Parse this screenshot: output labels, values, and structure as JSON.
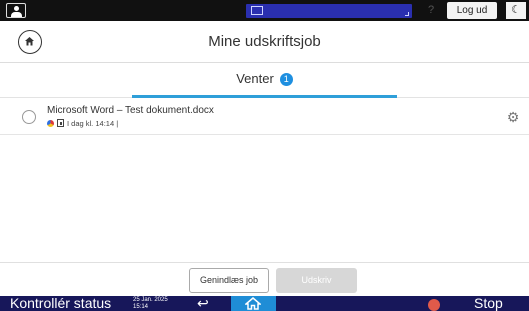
{
  "topbar": {
    "user_icon": "user-icon",
    "help_icon": "help-icon",
    "help_symbol": "?",
    "logout_label": "Log ud",
    "moon_icon": "moon-icon",
    "moon_symbol": "☾"
  },
  "header": {
    "home_icon": "home-icon",
    "title": "Mine udskriftsjob"
  },
  "tab": {
    "label": "Venter",
    "badge": "1"
  },
  "jobs": [
    {
      "name": "Microsoft Word – Test dokument.docx",
      "meta": "I dag kl. 14:14 |",
      "color_icon": "color-icon",
      "doc_icon": "document-icon",
      "settings_icon": "gear-icon",
      "settings_symbol": "⚙"
    }
  ],
  "actions": {
    "reload_label": "Genindlæs job",
    "print_label": "Udskriv"
  },
  "statusbar": {
    "status_label": "Kontrollér status",
    "date_line1": "25 Jan. 2025",
    "date_line2": "15:14",
    "back_icon": "back-arrow-icon",
    "back_symbol": "↩",
    "home_icon": "home-icon",
    "stop_icon": "stop-icon",
    "stop_label": "Stop"
  },
  "colors": {
    "accent": "#2f9fd9",
    "badge": "#1e8fe0",
    "statusbar": "#17175a",
    "topbar_field": "#2a2fb0"
  }
}
